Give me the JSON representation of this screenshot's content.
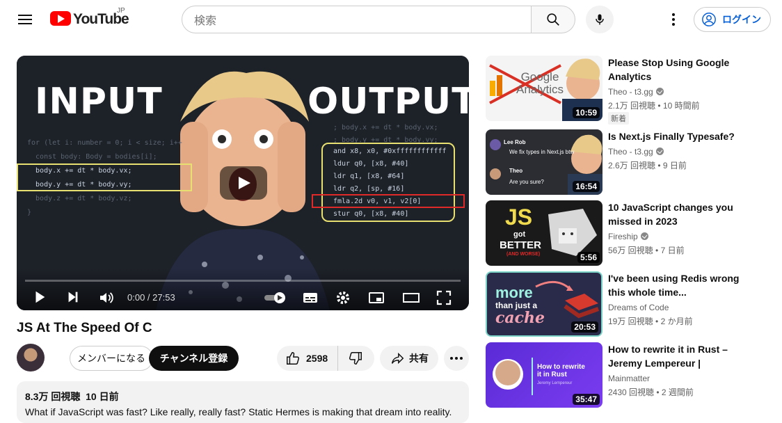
{
  "masthead": {
    "logo_text": "YouTube",
    "country_code": "JP",
    "search_placeholder": "検索",
    "signin_label": "ログイン"
  },
  "player": {
    "thumb_text_left": "INPUT",
    "thumb_text_right": "OUTPUT",
    "time_current": "0:00",
    "time_separator": " / ",
    "time_total": "27:53",
    "code_left": [
      "for (let i: number = 0; i < size; i++",
      "  const body: Body = bodies[i];",
      "  body.x += dt * body.vx;",
      "  body.y += dt * body.vy;",
      "  body.z += dt * body.vz;",
      "}"
    ],
    "code_right": [
      "; body.x += dt * body.vx;",
      "; body.y += dt * body.vy;",
      "and x8, x0, #0xffffffffffff",
      "ldur q0, [x8, #40]",
      "ldr q1, [x8, #64]",
      "ldr q2, [sp, #16]",
      "fmla.2d v0, v1, v2[0]",
      "stur q0, [x8, #40]"
    ]
  },
  "video": {
    "title": "JS At The Speed Of C",
    "member_label": "メンバーになる",
    "subscribe_label": "チャンネル登録",
    "like_count": "2598",
    "share_label": "共有",
    "views": "8.3万 回視聴",
    "date": "10 日前",
    "description": "What if JavaScript was fast? Like really, really fast? Static Hermes is making that dream into reality."
  },
  "recommendations": [
    {
      "title": "Please Stop Using Google Analytics",
      "channel": "Theo - t3.gg",
      "verified": true,
      "views": "2.1万 回視聴",
      "age": "10 時間前",
      "badge": "新着",
      "duration": "10:59",
      "thumb_text": "Google Analytics"
    },
    {
      "title": "Is Next.js Finally Typesafe?",
      "channel": "Theo - t3.gg",
      "verified": true,
      "views": "2.6万 回視聴",
      "age": "9 日前",
      "duration": "16:54",
      "thumb_lines": [
        "Lee Rob",
        "We fix types in Next.js btw",
        "Theo",
        "Are you sure?"
      ]
    },
    {
      "title": "10 JavaScript changes you missed in 2023",
      "channel": "Fireship",
      "verified": true,
      "views": "56万 回視聴",
      "age": "7 日前",
      "duration": "5:56",
      "thumb_lines": [
        "JS",
        "got",
        "BETTER",
        "(AND WORSE)"
      ]
    },
    {
      "title": "I've been using Redis wrong this whole time...",
      "channel": "Dreams of Code",
      "verified": false,
      "views": "19万 回視聴",
      "age": "2 か月前",
      "duration": "20:53",
      "thumb_lines": [
        "more",
        "than just a",
        "cache"
      ]
    },
    {
      "title": "How to rewrite it in Rust – Jeremy Lempereur | Mainmatt…",
      "channel": "Mainmatter",
      "verified": false,
      "views": "2430 回視聴",
      "age": "2 週間前",
      "duration": "35:47",
      "thumb_lines": [
        "How to rewrite",
        "it in Rust",
        "Jeremy Lempereur"
      ]
    }
  ],
  "colors": {
    "accent": "#065fd4",
    "brand": "#ff0000",
    "code_box": "#e8e070",
    "code_highlight": "#e02a2a"
  }
}
